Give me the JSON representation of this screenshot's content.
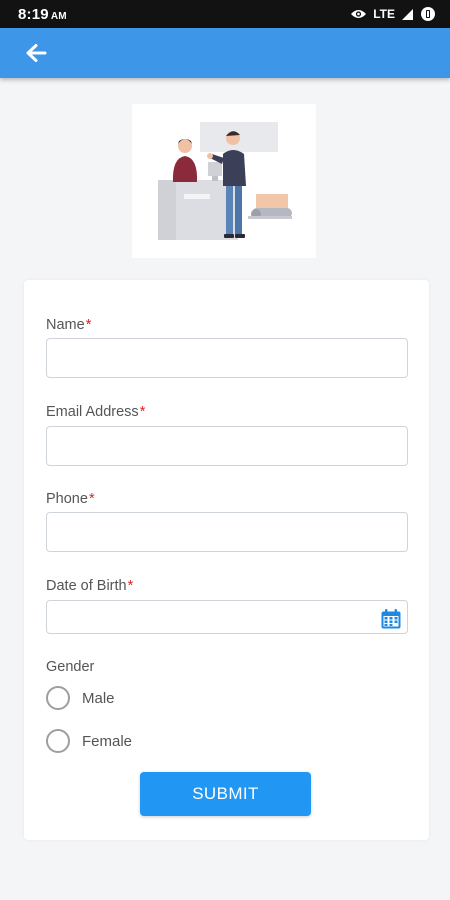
{
  "status_bar": {
    "time": "8:19",
    "ampm": "AM",
    "network": "LTE"
  },
  "app_bar": {
    "back_icon": "arrow-left-icon"
  },
  "colors": {
    "accent": "#3d96e8",
    "button": "#2196f3",
    "required": "#e02020"
  },
  "form": {
    "name_label": "Name",
    "email_label": "Email Address",
    "phone_label": "Phone",
    "dob_label": "Date of Birth",
    "required_mark": "*",
    "gender_label": "Gender",
    "gender_options": [
      "Male",
      "Female"
    ],
    "submit_label": "SUBMIT"
  }
}
